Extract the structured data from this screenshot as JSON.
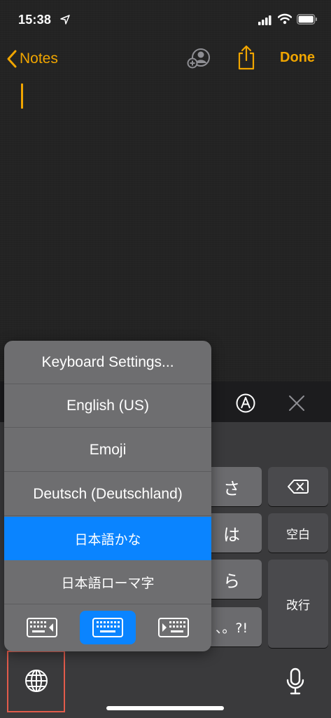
{
  "status_bar": {
    "time": "15:38"
  },
  "nav": {
    "back_label": "Notes",
    "done_label": "Done"
  },
  "keyboard": {
    "keys": {
      "sa": "さ",
      "ha": "は",
      "ra": "ら",
      "punct": "、。?!",
      "space": "空白",
      "return": "改行"
    }
  },
  "language_menu": {
    "items": [
      {
        "label": "Keyboard Settings...",
        "selected": false
      },
      {
        "label": "English (US)",
        "selected": false
      },
      {
        "label": "Emoji",
        "selected": false
      },
      {
        "label": "Deutsch (Deutschland)",
        "selected": false
      },
      {
        "label": "日本語かな",
        "selected": true
      },
      {
        "label": "日本語ローマ字",
        "selected": false
      }
    ],
    "layout_options": [
      "keyboard-left-icon",
      "keyboard-full-icon",
      "keyboard-right-icon"
    ],
    "active_layout": "keyboard-full-icon"
  },
  "colors": {
    "accent": "#f0a500",
    "selection": "#0a84ff",
    "highlight_border": "#e25b4b"
  }
}
